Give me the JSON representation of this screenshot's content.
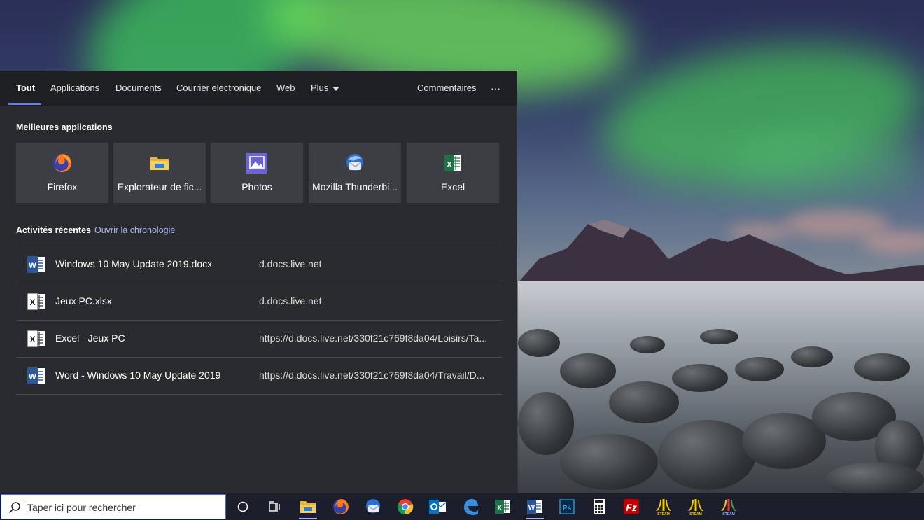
{
  "tabs": [
    {
      "label": "Tout",
      "active": true
    },
    {
      "label": "Applications"
    },
    {
      "label": "Documents"
    },
    {
      "label": "Courrier electronique"
    },
    {
      "label": "Web"
    },
    {
      "label": "Plus"
    }
  ],
  "header": {
    "feedback": "Commentaires",
    "more": "···"
  },
  "best_apps": {
    "title": "Meilleures applications",
    "items": [
      {
        "label": "Firefox",
        "icon": "firefox-icon"
      },
      {
        "label": "Explorateur de fic...",
        "icon": "file-explorer-icon"
      },
      {
        "label": "Photos",
        "icon": "photos-icon"
      },
      {
        "label": "Mozilla Thunderbi...",
        "icon": "thunderbird-icon"
      },
      {
        "label": "Excel",
        "icon": "excel-icon"
      }
    ]
  },
  "recent": {
    "title": "Activités récentes",
    "timeline_link": "Ouvrir la chronologie",
    "items": [
      {
        "name": "Windows 10 May Update 2019.docx",
        "location": "d.docs.live.net",
        "icon": "word-icon"
      },
      {
        "name": "Jeux PC.xlsx",
        "location": "d.docs.live.net",
        "icon": "excel-doc-icon"
      },
      {
        "name": "Excel - Jeux PC",
        "location": "https://d.docs.live.net/330f21c769f8da04/Loisirs/Ta...",
        "icon": "excel-doc-icon"
      },
      {
        "name": "Word - Windows 10 May Update 2019",
        "location": "https://d.docs.live.net/330f21c769f8da04/Travail/D...",
        "icon": "word-icon"
      }
    ]
  },
  "taskbar": {
    "search_placeholder": "Taper ici pour rechercher",
    "icons": [
      "cortana-icon",
      "task-view-icon",
      "file-explorer-icon",
      "firefox-icon",
      "thunderbird-icon",
      "chrome-icon",
      "outlook-icon",
      "edge-icon",
      "excel-icon",
      "word-icon",
      "photoshop-icon",
      "calculator-icon",
      "filezilla-icon",
      "steam-icon",
      "steam-icon",
      "steam-icon"
    ],
    "steam_labels": [
      "STEAM",
      "STEAM",
      "STEAM"
    ]
  },
  "colors": {
    "accent": "#6a7fe0",
    "panel": "#2a2b2f",
    "tile": "#3d3e43",
    "link": "#a9b4f2"
  }
}
